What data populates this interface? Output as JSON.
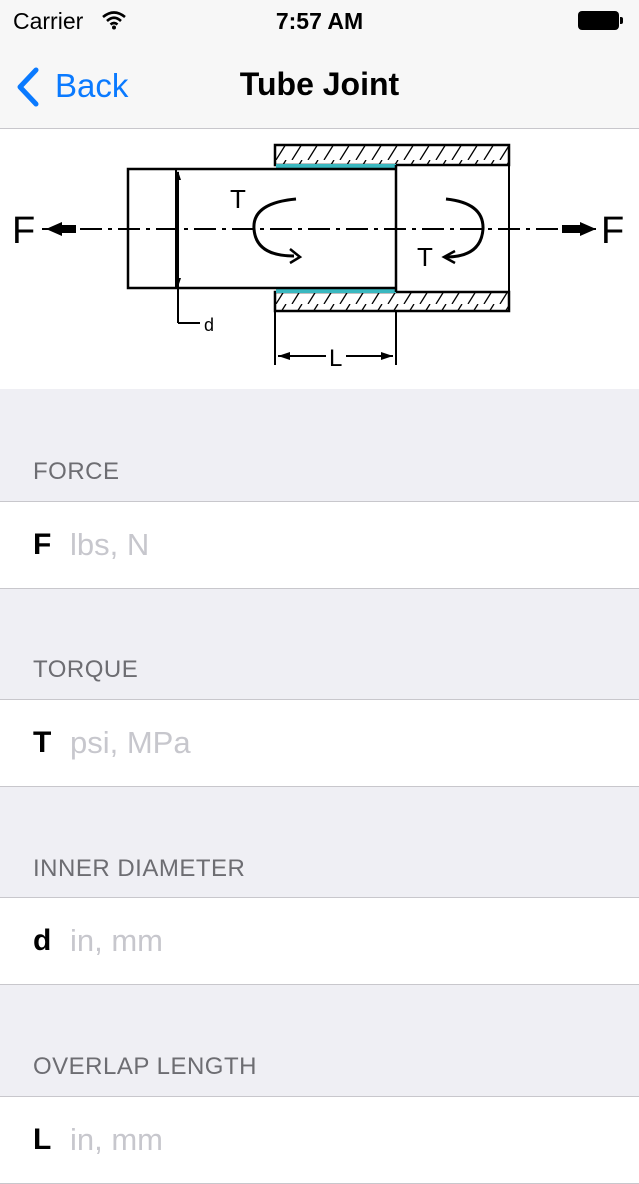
{
  "status_bar": {
    "carrier": "Carrier",
    "time": "7:57 AM",
    "wifi_icon": "wifi-icon",
    "battery_icon": "battery-icon"
  },
  "nav": {
    "back_label": "Back",
    "title": "Tube Joint",
    "accent_color": "#0a7aff"
  },
  "diagram": {
    "labels": {
      "force_left": "F",
      "force_right": "F",
      "torque_left": "T",
      "torque_right": "T",
      "diameter": "d",
      "length": "L"
    },
    "adhesive_color": "#3ab8c0"
  },
  "fields": [
    {
      "header": "FORCE",
      "symbol": "F",
      "value": "",
      "placeholder": "lbs, N"
    },
    {
      "header": "TORQUE",
      "symbol": "T",
      "value": "",
      "placeholder": "psi, MPa"
    },
    {
      "header": "INNER DIAMETER",
      "symbol": "d",
      "value": "",
      "placeholder": "in, mm"
    },
    {
      "header": "OVERLAP LENGTH",
      "symbol": "L",
      "value": "",
      "placeholder": "in, mm"
    }
  ]
}
